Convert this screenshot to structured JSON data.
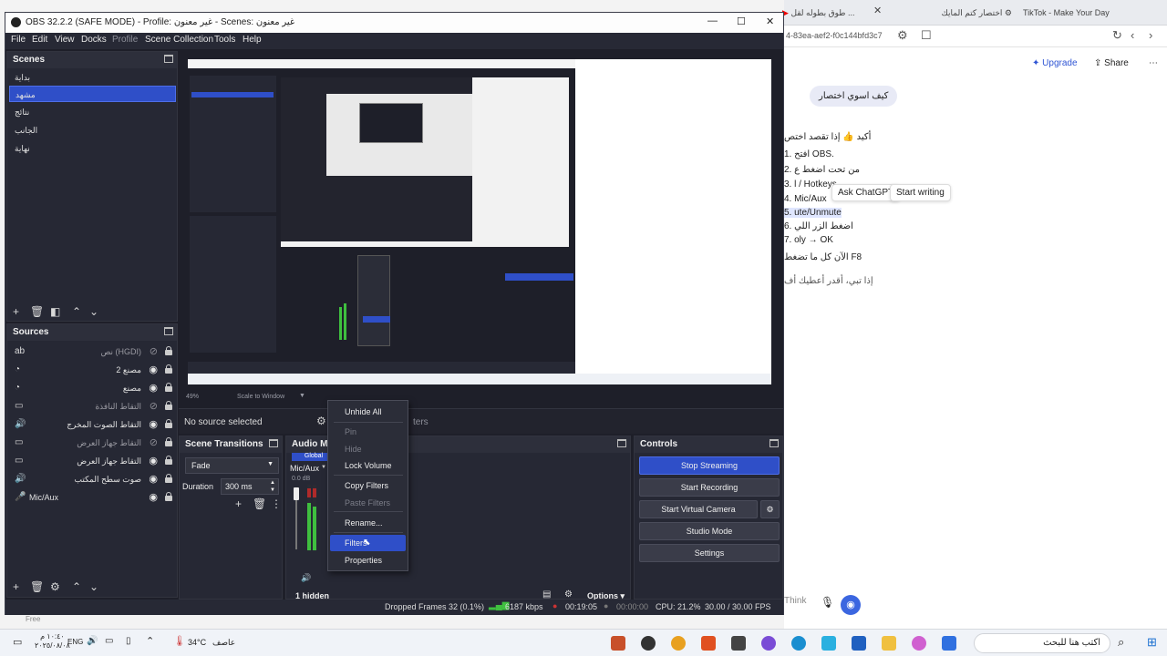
{
  "browser": {
    "tabs": [
      "طوق بطوله لقل ...",
      "اختصار كتم المايك",
      "TikTok - Make Your Day"
    ],
    "address": "4-83ea-aef2-f0c144bfd3c7",
    "upgrade": "Upgrade",
    "share": "Share",
    "question": "كيف اسوي اختصار",
    "lines": [
      "أكيد 👍 إذا تقصد اختص",
      "1. افتح OBS.",
      "2. من تحت اضغط ع",
      "3. l / Hotkeys",
      "4. Mic/Aux",
      "5. ute/Unmute",
      "6. اضغط الزر اللي",
      "7. oly → OK",
      "الآن كل ما تضغط F8",
      "إذا تبي، أقدر أعطيك أف"
    ],
    "ask_chatgpt": "Ask ChatGPT",
    "start_writing": "Start writing",
    "think": "Think"
  },
  "titlebar": {
    "title": "OBS 32.2.2 (SAFE MODE) - Profile: غير معنون - Scenes: غير معنون"
  },
  "menu": [
    "File",
    "Edit",
    "View",
    "Docks",
    "Profile",
    "Scene Collection",
    "Tools",
    "Help"
  ],
  "scenes": {
    "title": "Scenes",
    "items": [
      "بداية",
      "مشهد",
      "نتائج",
      "الجانب",
      "نهاية"
    ]
  },
  "sources": {
    "title": "Sources",
    "items": [
      {
        "icon": "ab",
        "label": "نص (HGDI)",
        "dim": true,
        "ltr": false
      },
      {
        "icon": "◔",
        "label": "مصنع 2",
        "dim": false,
        "ltr": false
      },
      {
        "icon": "◔",
        "label": "مصنع",
        "dim": false,
        "ltr": false
      },
      {
        "icon": "▭",
        "label": "التقاط النافذة",
        "dim": true,
        "ltr": false
      },
      {
        "icon": "🔊",
        "label": "التقاط الصوت المخرج",
        "dim": false,
        "ltr": false
      },
      {
        "icon": "▭",
        "label": "التقاط جهاز العرض",
        "dim": true,
        "ltr": false
      },
      {
        "icon": "▭",
        "label": "التقاط جهاز العرض",
        "dim": false,
        "ltr": false
      },
      {
        "icon": "🔊",
        "label": "صوت سطح المكتب",
        "dim": false,
        "ltr": false
      },
      {
        "icon": "🎤",
        "label": "Mic/Aux",
        "dim": false,
        "ltr": true
      }
    ]
  },
  "preview_bar": {
    "zoom": "49%",
    "scale": "Scale to Window"
  },
  "no_source": "No source selected",
  "filters_partial": "ters",
  "transitions": {
    "title": "Scene Transitions",
    "type": "Fade",
    "duration_label": "Duration",
    "duration": "300 ms"
  },
  "audio": {
    "title": "Audio Mi",
    "global": "Global",
    "channel": "Mic/Aux",
    "db": "0.0 dB",
    "hidden": "1 hidden"
  },
  "controls": {
    "title": "Controls",
    "stop_streaming": "Stop Streaming",
    "start_recording": "Start Recording",
    "start_virtual_camera": "Start Virtual Camera",
    "studio_mode": "Studio Mode",
    "settings": "Settings"
  },
  "context_menu": {
    "unhide_all": "Unhide All",
    "pin": "Pin",
    "hide": "Hide",
    "lock_volume": "Lock Volume",
    "copy_filters": "Copy Filters",
    "paste_filters": "Paste Filters",
    "rename": "Rename...",
    "filters": "Filters",
    "properties": "Properties"
  },
  "options": "Options",
  "status": {
    "dropped": "Dropped Frames 32 (0.1%)",
    "kbps": "6187 kbps",
    "time1": "00:19:05",
    "time2": "00:00:00",
    "cpu": "CPU: 21.2%",
    "fps": "30.00 / 30.00 FPS"
  },
  "taskbar": {
    "lang": "ENG",
    "temp": "34°C",
    "weather": "عاصف",
    "search": "اكتب هنا للبحث",
    "date": "٢٠٢٥/٠٨/٠٨",
    "time": "١٠:٤٠ م",
    "free": "Free"
  },
  "colors": {
    "accent": "#2f4fc8",
    "obs_bg": "#1e1f29",
    "dock_bg": "#262834",
    "meter_green": "#3fbf3f"
  }
}
